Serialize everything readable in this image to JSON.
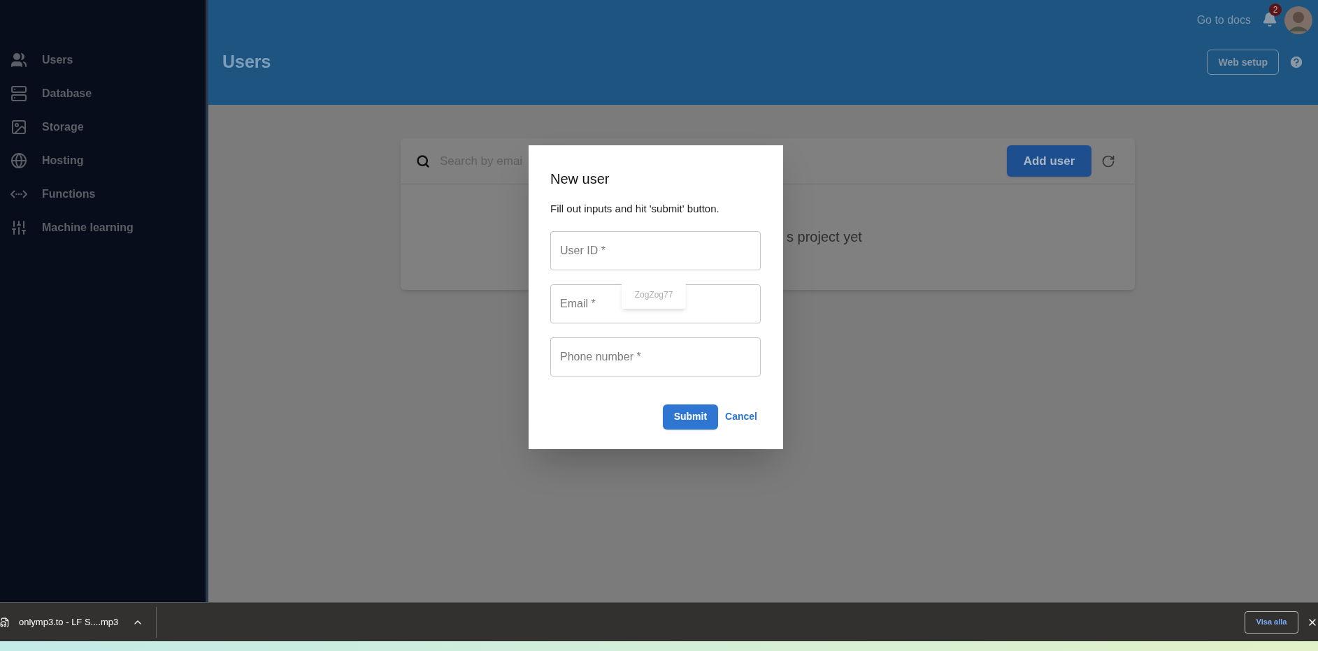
{
  "sidebar": {
    "items": [
      {
        "label": "Users",
        "kind": "users"
      },
      {
        "label": "Database",
        "kind": "database"
      },
      {
        "label": "Storage",
        "kind": "storage"
      },
      {
        "label": "Hosting",
        "kind": "hosting"
      },
      {
        "label": "Functions",
        "kind": "functions"
      },
      {
        "label": "Machine learning",
        "kind": "ml"
      }
    ]
  },
  "header": {
    "title": "Users",
    "docs_link": "Go to docs",
    "notification_count": "2",
    "web_setup_button": "Web setup"
  },
  "users_card": {
    "search": {
      "placeholder": "Search by emai"
    },
    "add_button": "Add user",
    "empty_message": "s project yet"
  },
  "dialog": {
    "title": "New user",
    "description": "Fill out inputs and hit 'submit' button.",
    "fields": [
      {
        "placeholder": "User ID *"
      },
      {
        "placeholder": "Email *"
      },
      {
        "placeholder": "Phone number *"
      }
    ],
    "autofill_suggestion": "ZogZog77",
    "submit_button": "Submit",
    "cancel_button": "Cancel"
  },
  "download_bar": {
    "file_name": "onlymp3.to - LF S....mp3",
    "show_all_button": "Visa alla"
  }
}
